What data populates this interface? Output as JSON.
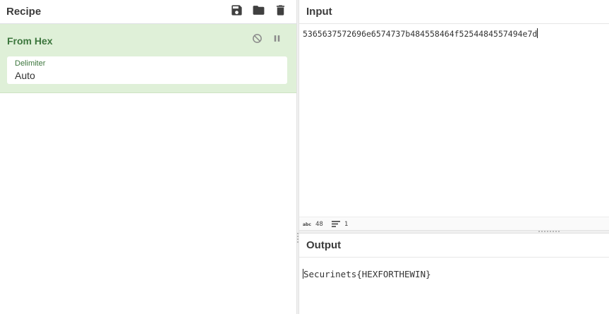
{
  "recipe": {
    "title": "Recipe",
    "tools": [
      {
        "name": "save-recipe",
        "icon": "save-icon"
      },
      {
        "name": "load-recipe",
        "icon": "folder-icon"
      },
      {
        "name": "clear-recipe",
        "icon": "trash-icon"
      }
    ],
    "operation": {
      "name": "From Hex",
      "controls": [
        {
          "name": "disable-op",
          "icon": "disable-icon"
        },
        {
          "name": "breakpoint-op",
          "icon": "pause-icon"
        }
      ],
      "argument": {
        "label": "Delimiter",
        "value": "Auto"
      }
    }
  },
  "input": {
    "title": "Input",
    "text": "5365637572696e6574737b484558464f5254484557494e7d",
    "stats": {
      "length": "48",
      "lines": "1"
    }
  },
  "output": {
    "title": "Output",
    "text": "Securinets{HEXFORTHEWIN}"
  },
  "colors": {
    "operation_bg": "#dff0d8",
    "operation_text": "#3c763d",
    "header_text": "#3b3b3b"
  }
}
